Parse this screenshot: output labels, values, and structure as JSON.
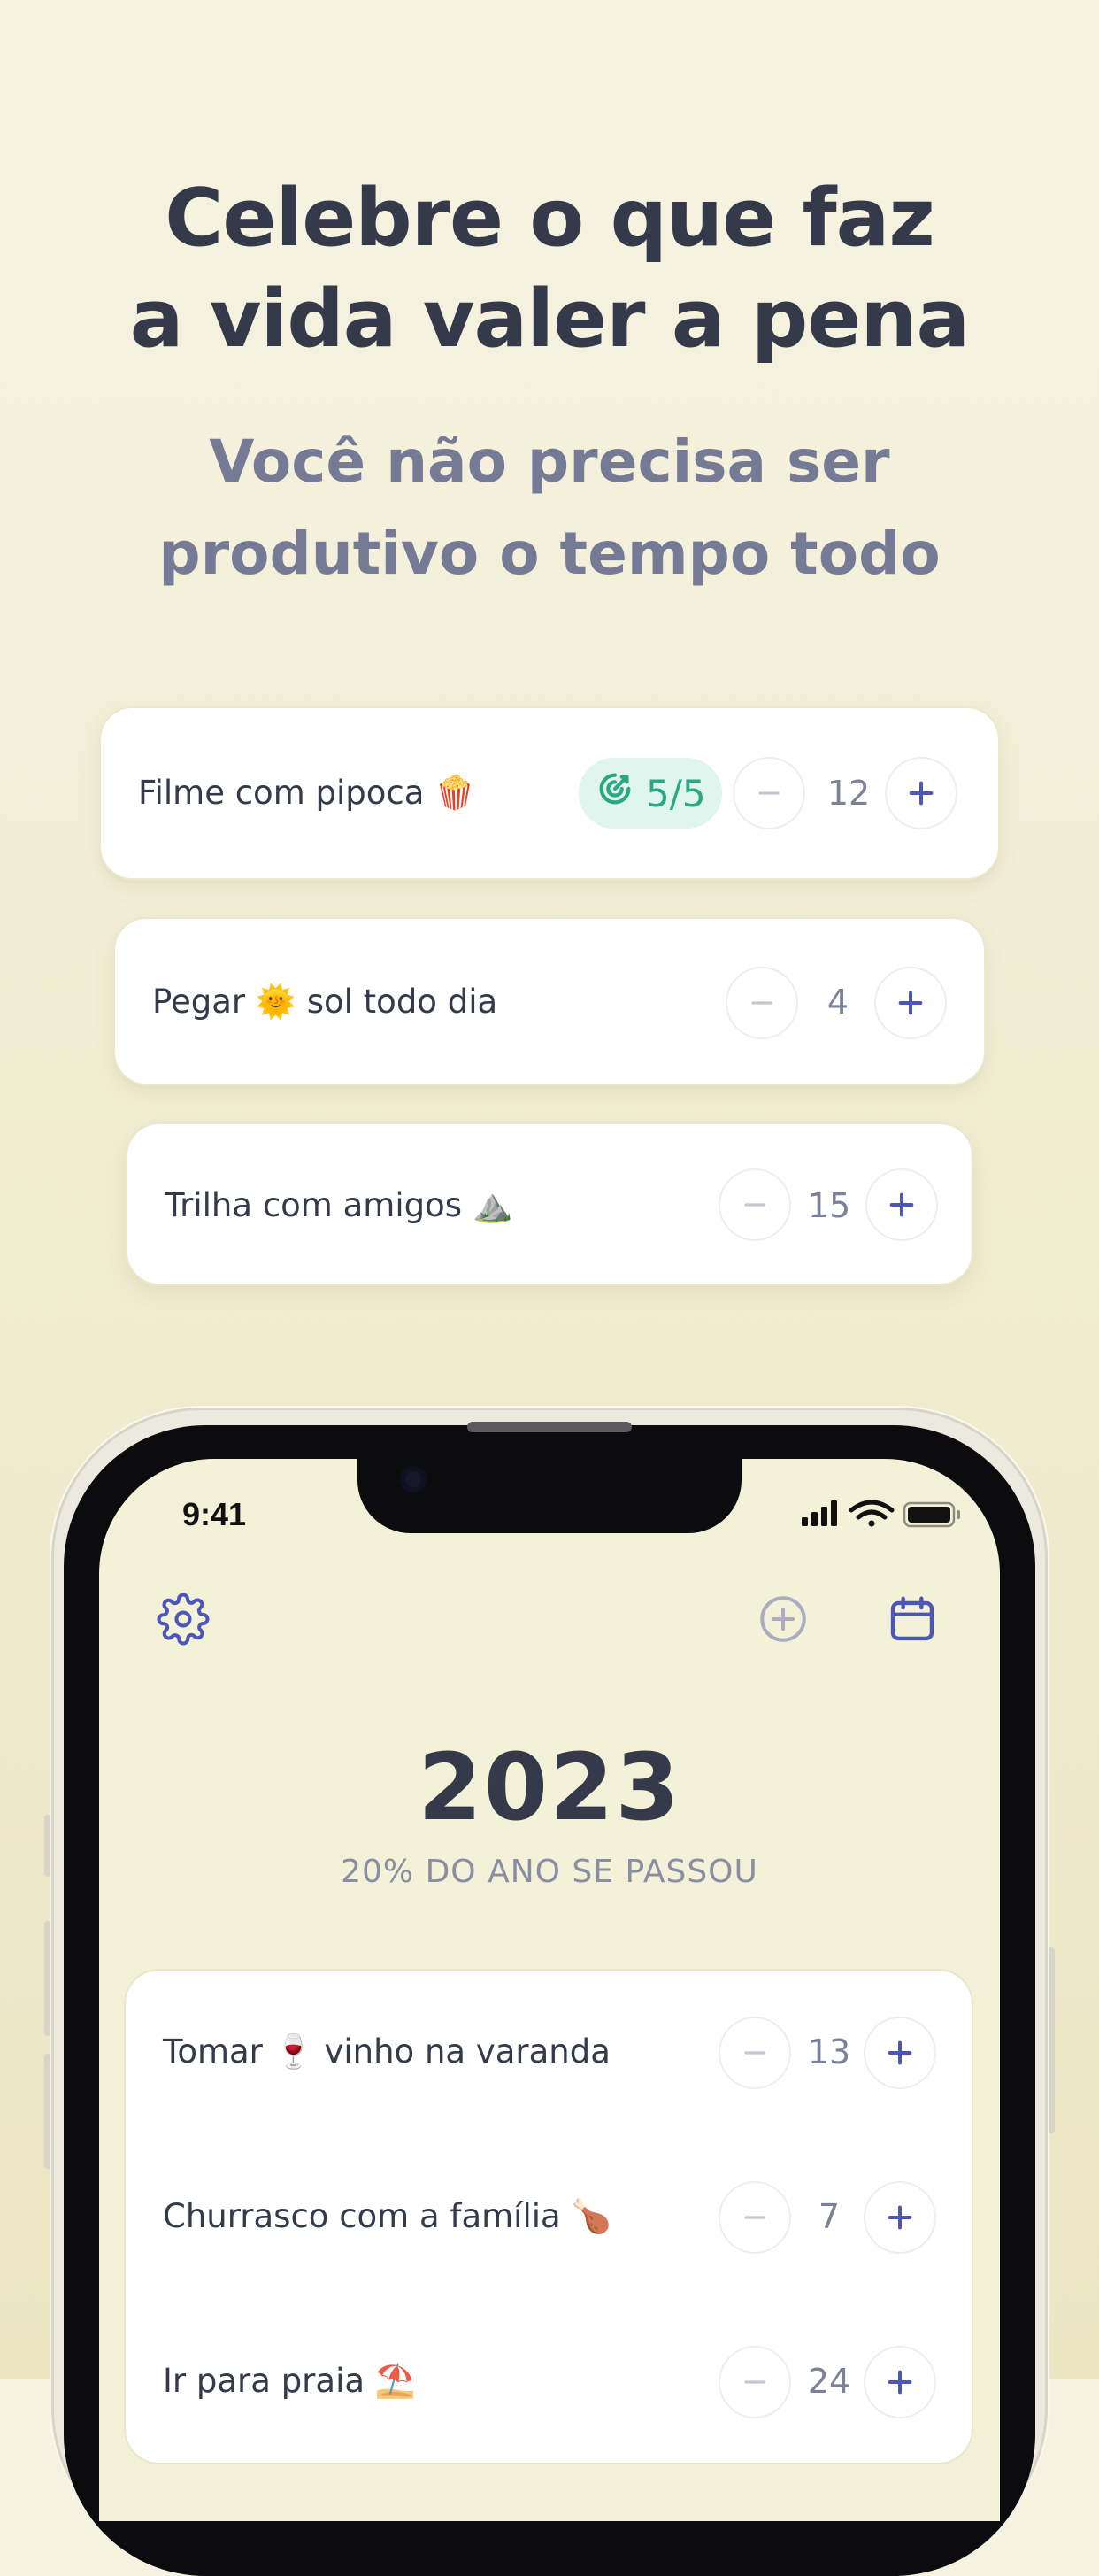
{
  "headline": {
    "line1": "Celebre o que faz",
    "line2": "a vida valer a pena"
  },
  "subheadline": {
    "line1": "Você não precisa ser",
    "line2": "produtivo o tempo todo"
  },
  "feature_cards": [
    {
      "label": "Filme com pipoca 🍿",
      "badge": "5/5",
      "count": "12"
    },
    {
      "label": "Pegar 🌞 sol todo dia",
      "count": "4"
    },
    {
      "label": "Trilha com amigos ⛰️",
      "count": "15"
    }
  ],
  "phone": {
    "status_time": "9:41",
    "year": "2023",
    "year_progress": "20% DO ANO SE PASSOU",
    "items": [
      {
        "label": "Tomar 🍷 vinho na varanda",
        "count": "13"
      },
      {
        "label": "Churrasco com a família 🍗",
        "count": "7"
      },
      {
        "label": "Ir para praia ⛱️",
        "count": "24"
      }
    ]
  },
  "icons": {
    "settings": "gear-icon",
    "add": "plus-circle-icon",
    "calendar": "calendar-icon",
    "goal": "target-icon"
  },
  "colors": {
    "text_dark": "#353a4a",
    "text_muted": "#767b95",
    "accent": "#4b56b8",
    "goal_green": "#2aa881",
    "goal_bg": "#dff5ee"
  }
}
